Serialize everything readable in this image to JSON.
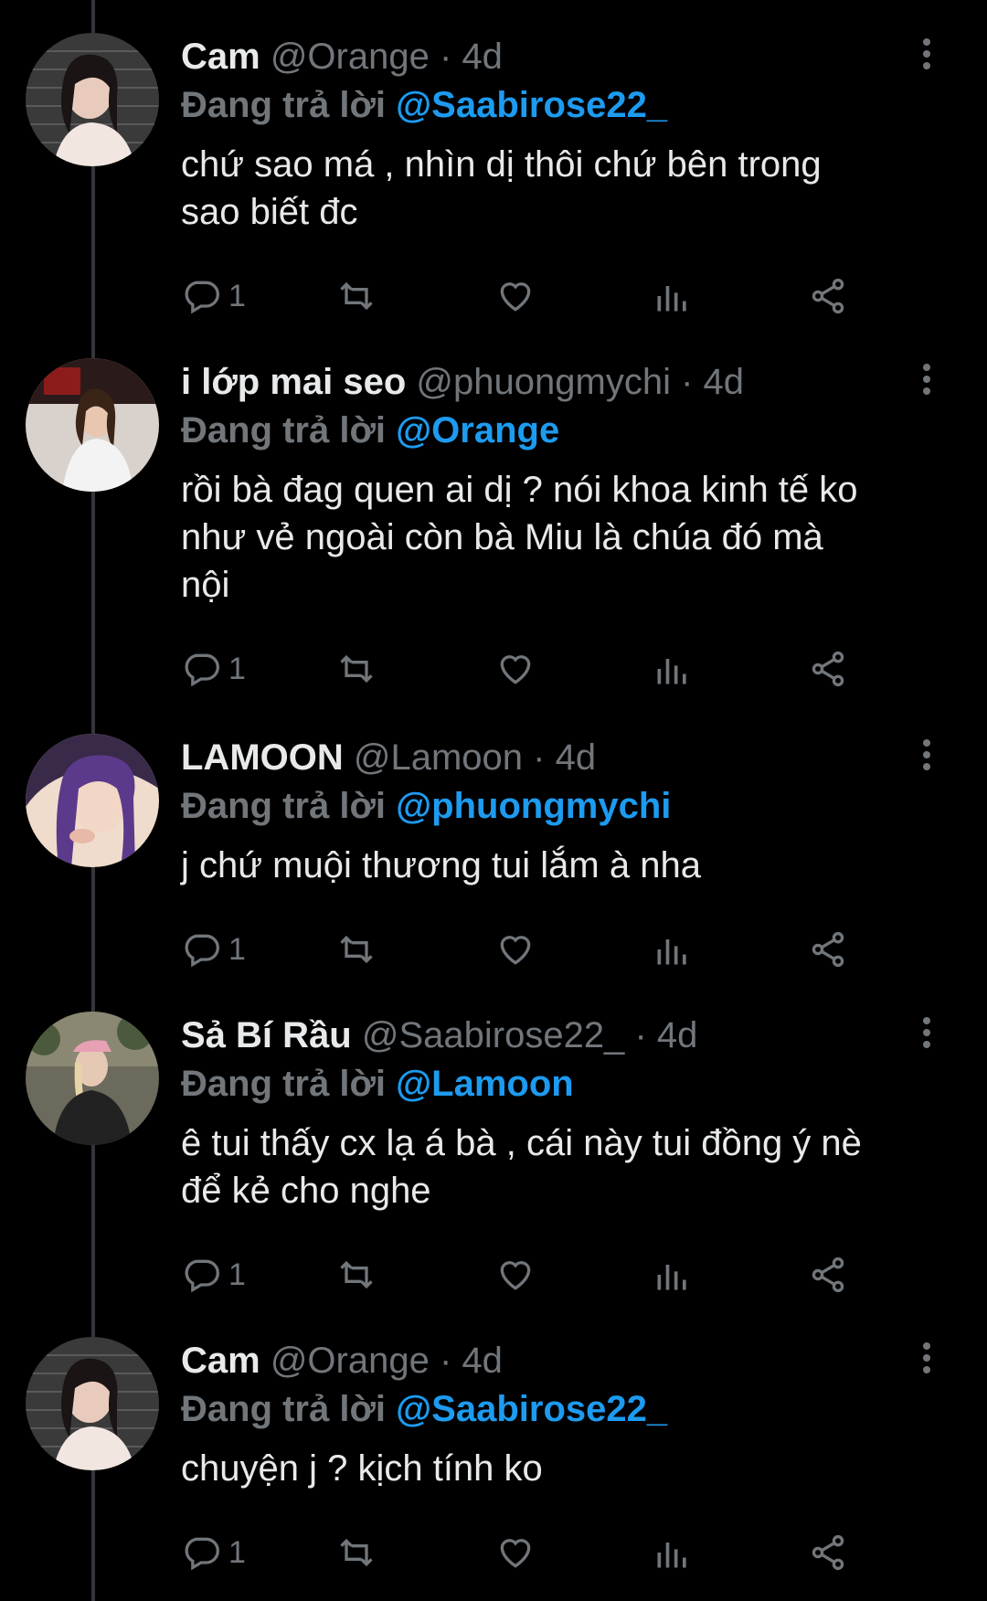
{
  "tweets": [
    {
      "name": "Cam",
      "handle": "@Orange",
      "separator": "·",
      "time": "4d",
      "replying_prefix": "Đang trả lời",
      "replying_to": "@Saabirose22_",
      "text_lines": [
        "chứ sao má , nhìn dị thôi chứ bên trong",
        "sao biết đc"
      ],
      "reply_count": "1"
    },
    {
      "name": "i lớp mai seo",
      "handle": "@phuongmychi",
      "separator": "·",
      "time": "4d",
      "replying_prefix": "Đang trả lời",
      "replying_to": "@Orange",
      "text_lines": [
        "rồi bà đag quen ai dị ? nói khoa kinh tế ko",
        "như vẻ ngoài còn bà Miu là chúa đó mà",
        "nội"
      ],
      "reply_count": "1"
    },
    {
      "name": "LAMOON",
      "handle": "@Lamoon",
      "separator": "·",
      "time": "4d",
      "replying_prefix": "Đang trả lời",
      "replying_to": "@phuongmychi",
      "text_lines": [
        "j chứ muội thương tui lắm à nha"
      ],
      "reply_count": "1"
    },
    {
      "name": "Sả Bí Rầu",
      "handle": "@Saabirose22_",
      "separator": "·",
      "time": "4d",
      "replying_prefix": "Đang trả lời",
      "replying_to": "@Lamoon",
      "text_lines": [
        "ê tui thấy cx lạ á bà , cái này tui đồng ý nè",
        "để kẻ cho nghe"
      ],
      "reply_count": "1"
    },
    {
      "name": "Cam",
      "handle": "@Orange",
      "separator": "·",
      "time": "4d",
      "replying_prefix": "Đang trả lời",
      "replying_to": "@Saabirose22_",
      "text_lines": [
        "chuyện j ? kịch tính ko"
      ],
      "reply_count": "1"
    }
  ],
  "icons": {
    "reply": "reply-icon",
    "retweet": "retweet-icon",
    "like": "heart-icon",
    "views": "views-icon",
    "share": "share-icon",
    "more": "more-icon"
  },
  "colors": {
    "background": "#000000",
    "text": "#e7e9ea",
    "secondary": "#71767b",
    "link": "#1d9bf0",
    "thread_line": "#33363a"
  }
}
